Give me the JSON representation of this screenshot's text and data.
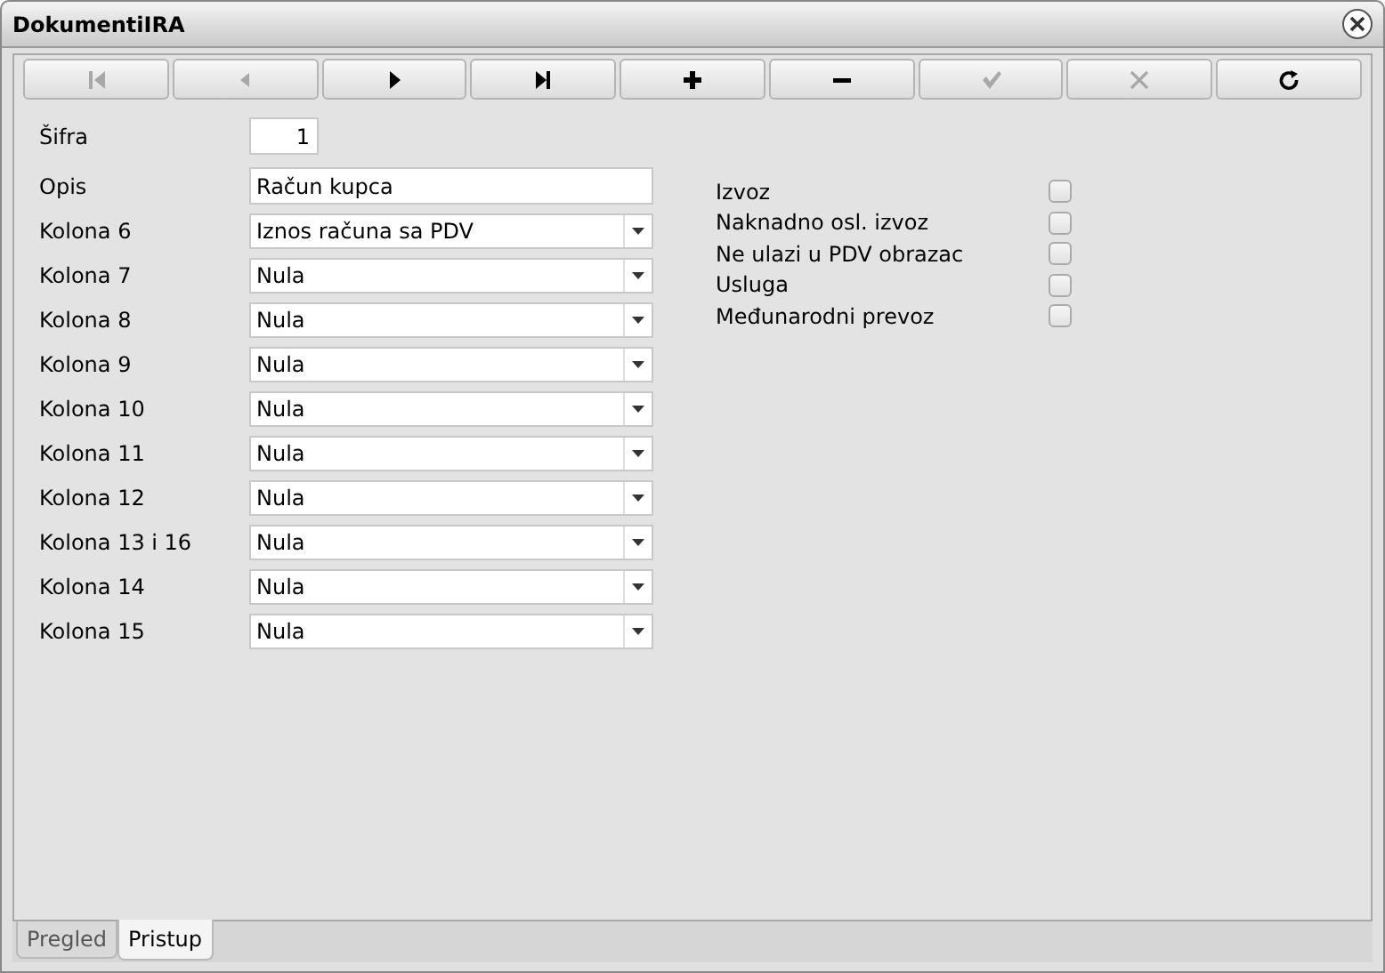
{
  "window": {
    "title": "DokumentiIRA"
  },
  "toolbar": [
    {
      "kind": "first",
      "disabled": true
    },
    {
      "kind": "prev",
      "disabled": true
    },
    {
      "kind": "next",
      "disabled": false
    },
    {
      "kind": "last",
      "disabled": false
    },
    {
      "kind": "add",
      "disabled": false
    },
    {
      "kind": "remove",
      "disabled": false
    },
    {
      "kind": "save",
      "disabled": true
    },
    {
      "kind": "cancel",
      "disabled": true
    },
    {
      "kind": "refresh",
      "disabled": false
    }
  ],
  "form": [
    {
      "kind": "number",
      "label": "Šifra",
      "value": "1"
    },
    {
      "kind": "text",
      "label": "Opis",
      "value": "Račun kupca"
    },
    {
      "kind": "select",
      "label": "Kolona 6",
      "value": "Iznos računa sa PDV"
    },
    {
      "kind": "select",
      "label": "Kolona 7",
      "value": "Nula"
    },
    {
      "kind": "select",
      "label": "Kolona 8",
      "value": "Nula"
    },
    {
      "kind": "select",
      "label": "Kolona 9",
      "value": "Nula"
    },
    {
      "kind": "select",
      "label": "Kolona 10",
      "value": "Nula"
    },
    {
      "kind": "select",
      "label": "Kolona 11",
      "value": "Nula"
    },
    {
      "kind": "select",
      "label": "Kolona 12",
      "value": "Nula"
    },
    {
      "kind": "select",
      "label": "Kolona 13 i 16",
      "value": "Nula"
    },
    {
      "kind": "select",
      "label": "Kolona 14",
      "value": "Nula"
    },
    {
      "kind": "select",
      "label": "Kolona 15",
      "value": "Nula"
    }
  ],
  "checkboxes": [
    {
      "label": "Izvoz",
      "checked": false
    },
    {
      "label": "Naknadno osl. izvoz",
      "checked": false
    },
    {
      "label": "Ne ulazi u PDV obrazac",
      "checked": false
    },
    {
      "label": "Usluga",
      "checked": false
    },
    {
      "label": "Međunarodni prevoz",
      "checked": false
    }
  ],
  "tabs": [
    {
      "label": "Pregled",
      "selected": false
    },
    {
      "label": "Pristup",
      "selected": true
    }
  ]
}
